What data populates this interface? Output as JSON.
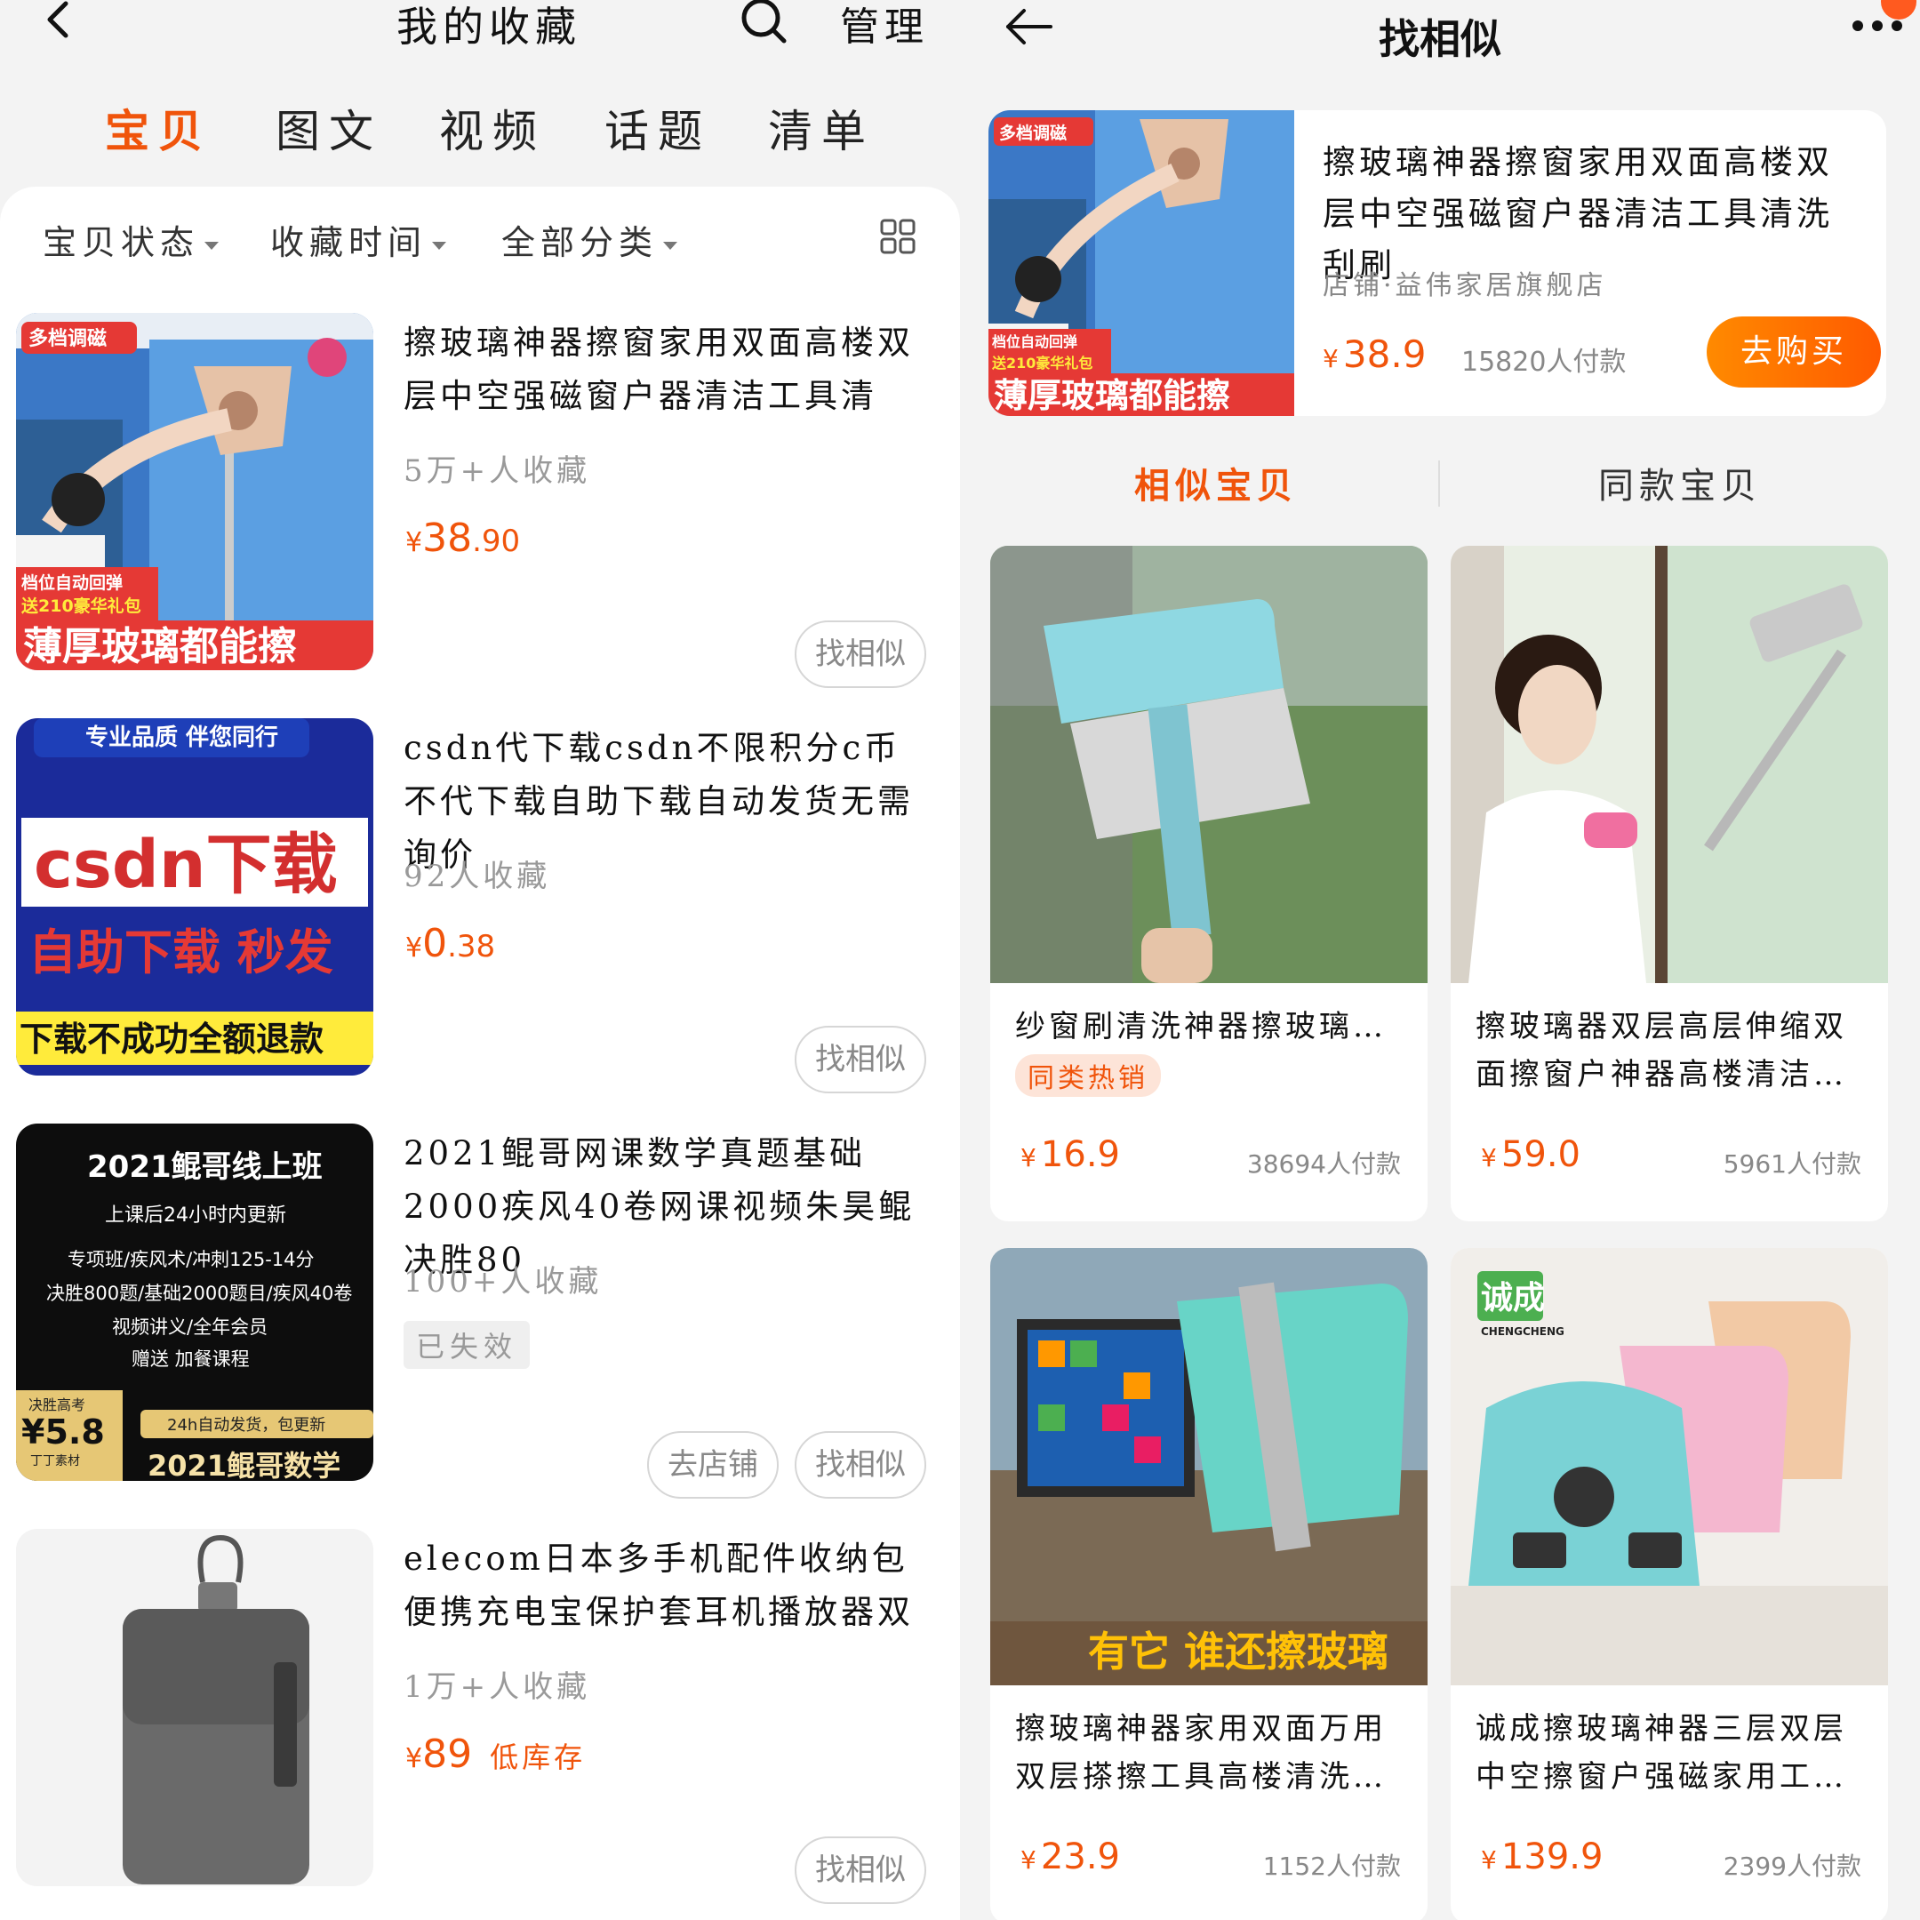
{
  "left": {
    "header": {
      "title": "我的收藏",
      "manage_label": "管理"
    },
    "tabs": [
      "宝贝",
      "图文",
      "视频",
      "话题",
      "清单"
    ],
    "filters": [
      "宝贝状态",
      "收藏时间",
      "全部分类"
    ],
    "items": [
      {
        "title": "擦玻璃神器擦窗家用双面高楼双层中空强磁窗户器清洁工具清",
        "favorites": "5万+人收藏",
        "price_int": "38",
        "price_dec": ".90",
        "find_similar": "找相似",
        "thumb": {
          "badge_top": "多档调磁",
          "badge_mid1": "档位自动回弹",
          "badge_mid2": "送210豪华礼包",
          "banner": "薄厚玻璃都能擦"
        }
      },
      {
        "title": "csdn代下载csdn不限积分c币不代下载自助下载自动发货无需询价",
        "favorites": "92人收藏",
        "price_int": "0",
        "price_dec": ".38",
        "find_similar": "找相似",
        "thumb": {
          "top": "专业品质 伴您同行",
          "big": "csdn下载",
          "mid": "自助下载 秒发",
          "bottom": "下载不成功全额退款"
        }
      },
      {
        "title": "2021鲲哥网课数学真题基础2000疾风40卷网课视频朱昊鲲决胜80",
        "favorites": "100+人收藏",
        "status": "已失效",
        "go_shop": "去店铺",
        "find_similar": "找相似",
        "thumb": {
          "title": "2021鲲哥线上班",
          "line1": "上课后24小时内更新",
          "line2": "专项班/疾风术/冲刺125-14分",
          "line3": "决胜800题/基础2000题目/疾风40卷",
          "line4": "视频讲义/全年会员",
          "line5": "赠送 加餐课程",
          "corner_label": "决胜高考",
          "corner_price": "¥5.8",
          "corner_sub": "丁丁素材",
          "ribbon": "24h自动发货，包更新",
          "bottom": "2021鲲哥数学"
        }
      },
      {
        "title": "elecom日本多手机配件收纳包便携充电宝保护套耳机播放器双",
        "favorites": "1万+人收藏",
        "price_int": "89",
        "stock": "低库存",
        "find_similar": "找相似"
      }
    ],
    "currency": "¥"
  },
  "right": {
    "header": {
      "title": "找相似"
    },
    "main": {
      "title": "擦玻璃神器擦窗家用双面高楼双层中空强磁窗户器清洁工具清洗刮刷",
      "shop": "店铺·益伟家居旗舰店",
      "price": "38.9",
      "paid": "15820人付款",
      "buy_label": "去购买"
    },
    "tabs": [
      "相似宝贝",
      "同款宝贝"
    ],
    "cards": [
      {
        "title": "纱窗刷清洗神器擦玻璃…",
        "tag": "同类热销",
        "price": "16.9",
        "paid": "38694人付款"
      },
      {
        "title": "擦玻璃器双层高层伸缩双面擦窗户神器高楼清洁…",
        "price": "59.0",
        "paid": "5961人付款"
      },
      {
        "title": "擦玻璃神器家用双面万用双层搽擦工具高楼清洗…",
        "price": "23.9",
        "paid": "1152人付款",
        "img_text": "有它 谁还擦玻璃"
      },
      {
        "title": "诚成擦玻璃神器三层双层中空擦窗户强磁家用工…",
        "price": "139.9",
        "paid": "2399人付款",
        "brand": "诚成",
        "brand_en": "CHENGCHENG"
      }
    ],
    "currency": "¥"
  }
}
